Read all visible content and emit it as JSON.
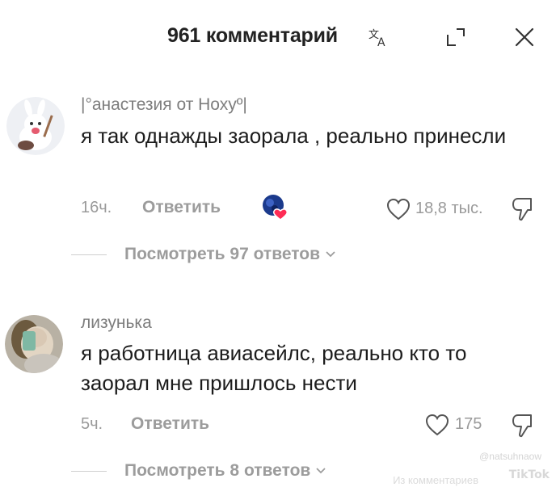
{
  "header": {
    "title": "961 комментарий",
    "translate_icon": "translate-icon",
    "popout_icon": "popout-icon",
    "close_icon": "close-icon"
  },
  "comments": [
    {
      "username": "|°анастезия от Нохуº|",
      "text": "я так однажды заорала , реально принесли",
      "time": "16ч.",
      "reply_label": "Ответить",
      "creator_liked": true,
      "likes": "18,8 тыс.",
      "view_replies": "Посмотреть 97 ответов"
    },
    {
      "username": "лизунька",
      "text": "я работница авиасейлс, реально кто то заорал мне пришлось нести",
      "time": "5ч.",
      "reply_label": "Ответить",
      "creator_liked": false,
      "likes": "175",
      "view_replies": "Посмотреть 8 ответов"
    }
  ],
  "watermark": {
    "user": "@natsuhnaow",
    "logo": "TikTok",
    "sub": "Из комментариев"
  },
  "colors": {
    "text": "#1c1c1c",
    "muted": "#9a9a9a",
    "heart_badge": "#fe2c55",
    "avatar_badge": "#1b3a8c"
  }
}
